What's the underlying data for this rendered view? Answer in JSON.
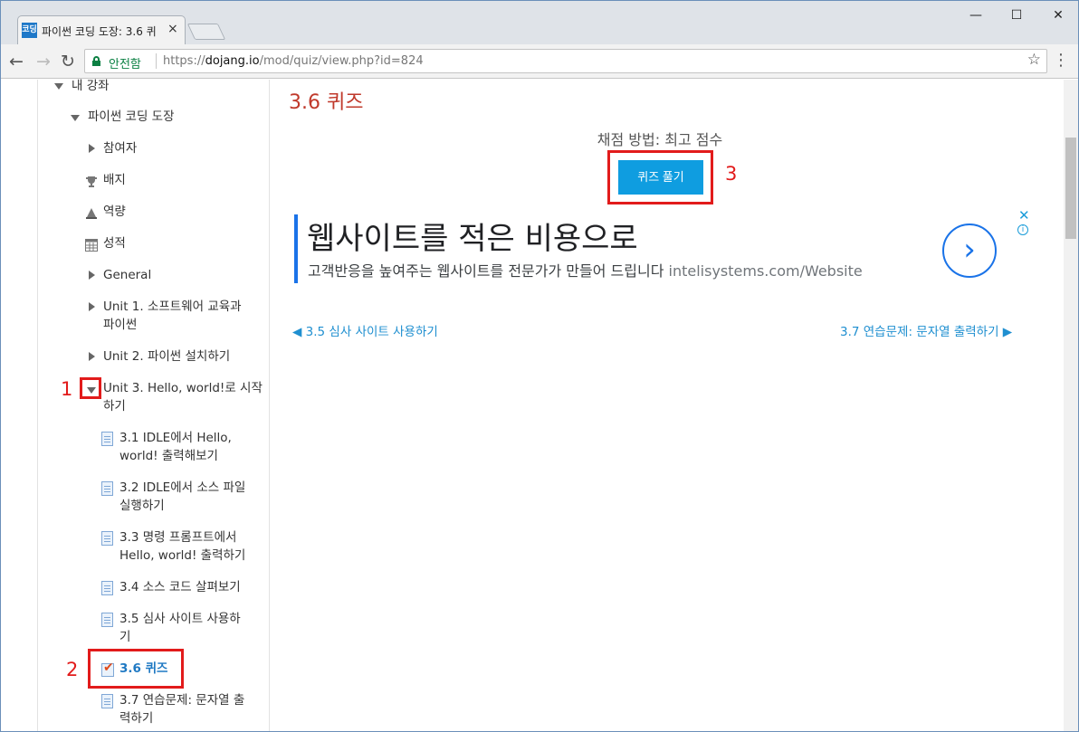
{
  "browser": {
    "tab_title": "파이썬 코딩 도장: 3.6 퀴",
    "tab_favicon": "코딩",
    "tab_close": "×",
    "minimize": "—",
    "maximize": "☐",
    "close": "✕",
    "back": "←",
    "forward": "→",
    "reload": "↻",
    "secure_label": "안전함",
    "url_scheme": "https://",
    "url_host": "dojang.io",
    "url_path": "/mod/quiz/view.php?id=824",
    "star": "☆",
    "menu": "⋮"
  },
  "sidebar": {
    "my_courses": "내 강좌",
    "course": "파이썬 코딩 도장",
    "participants": "참여자",
    "badges": "배지",
    "competencies": "역량",
    "grades": "성적",
    "general": "General",
    "unit1_line1": "Unit 1. 소프트웨어 교육과",
    "unit1_line2": "파이썬",
    "unit2": "Unit 2. 파이썬 설치하기",
    "unit3_line1": "Unit 3. Hello, world!로 시작",
    "unit3_line2": "하기",
    "item31_line1": "3.1 IDLE에서 Hello,",
    "item31_line2": "world! 출력해보기",
    "item32_line1": "3.2 IDLE에서 소스 파일",
    "item32_line2": "실행하기",
    "item33_line1": "3.3 명령 프롬프트에서",
    "item33_line2": "Hello, world! 출력하기",
    "item34": "3.4 소스 코드 살펴보기",
    "item35_line1": "3.5 심사 사이트 사용하",
    "item35_line2": "기",
    "item36": "3.6 퀴즈",
    "item37_line1": "3.7 연습문제: 문자열 출",
    "item37_line2": "력하기"
  },
  "main": {
    "title": "3.6 퀴즈",
    "grading_method": "채점 방법: 최고 점수",
    "attempt_button": "퀴즈 풀기",
    "prev_link": "◀ 3.5 심사 사이트 사용하기",
    "next_link": "3.7 연습문제: 문자열 출력하기 ▶"
  },
  "ad": {
    "headline": "웹사이트를 적은 비용으로",
    "body": "고객반응을 높여주는 웹사이트를 전문가가 만들어 드립니다",
    "domain": "intelisystems.com/Website",
    "arrow": "›",
    "close": "✕",
    "info": "i"
  },
  "annotations": {
    "n1": "1",
    "n2": "2",
    "n3": "3",
    "color": "#e21b1b"
  }
}
